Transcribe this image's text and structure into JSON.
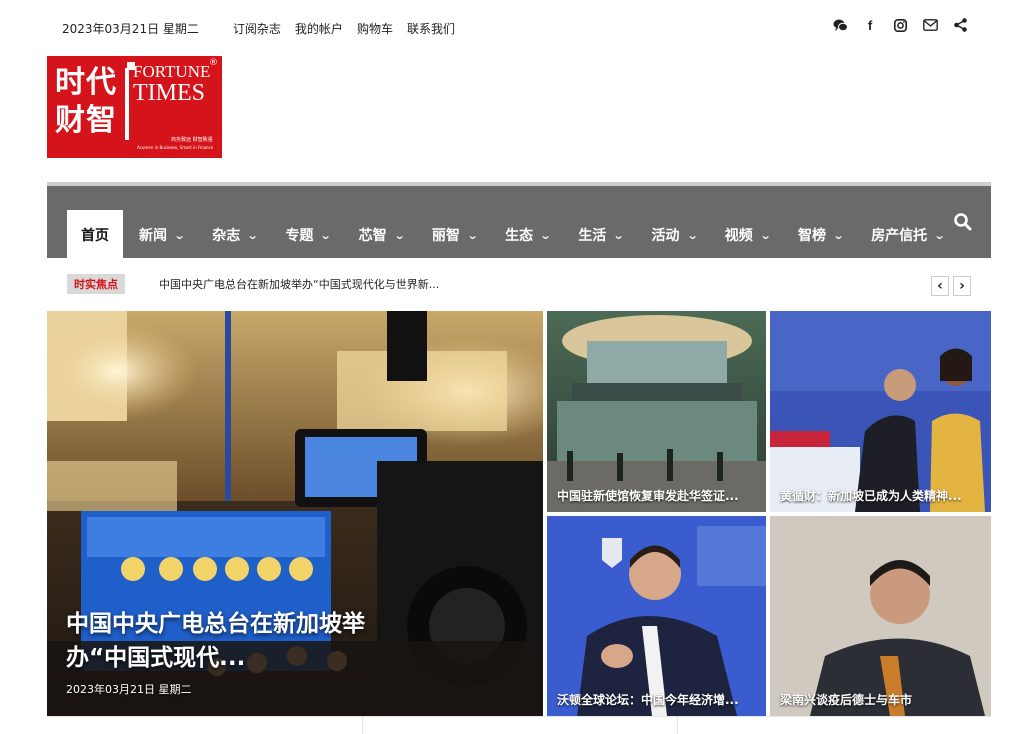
{
  "topbar": {
    "date": "2023年03月21日 星期二",
    "links": [
      "订阅杂志",
      "我的帐户",
      "购物车",
      "联系我们"
    ]
  },
  "social_icons": [
    "wechat-icon",
    "facebook-icon",
    "instagram-icon",
    "email-icon",
    "share-icon"
  ],
  "logo": {
    "cn_line1": "时代",
    "cn_line2": "财智",
    "en_line1": "FORTUNE",
    "en_line2": "TIMES",
    "reg": "®",
    "tagline_cn": "商务致远 财智致强",
    "tagline_en": "Acumen in Business, Smart in Finance",
    "color": "#d4141a"
  },
  "nav": {
    "items": [
      "首页",
      "新闻",
      "杂志",
      "专题",
      "芯智",
      "丽智",
      "生态",
      "生活",
      "活动",
      "视频",
      "智榜",
      "房产信托"
    ],
    "active_index": 0,
    "bar_color": "#6a6a6a"
  },
  "ticker": {
    "badge": "时实焦点",
    "headline": "中国中央广电总台在新加坡举办“中国式现代化与世界新...",
    "prev": "‹",
    "next": "›"
  },
  "featured": {
    "title": "中国中央广电总台在新加坡举办“中国式现代...",
    "date": "2023年03月21日 星期二"
  },
  "tiles": [
    {
      "caption": "中国驻新使馆恢复审发赴华签证..."
    },
    {
      "caption": "黄循财：新加坡已成为人类精神..."
    },
    {
      "caption": "沃顿全球论坛：中国今年经济增..."
    },
    {
      "caption": "梁南兴谈疫后德士与车市"
    }
  ]
}
